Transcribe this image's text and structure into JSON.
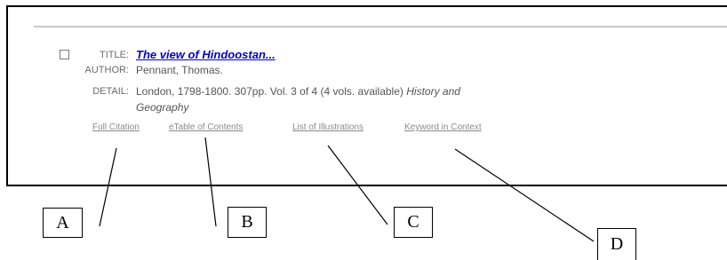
{
  "record": {
    "title_label": "TITLE:",
    "title_value": "The view of Hindoostan...",
    "author_label": "AUTHOR:",
    "author_value": "Pennant, Thomas.",
    "detail_label": "DETAIL:",
    "detail_value": "London, 1798-1800. 307pp. Vol. 3 of 4 (4 vols. available)",
    "detail_subject_1": "History and",
    "detail_subject_2": "Geography"
  },
  "links": {
    "full_citation": "Full Citation",
    "etable_of_contents": "eTable of Contents",
    "list_of_illustrations": "List of Illustrations",
    "keyword_in_context": "Keyword in Context"
  },
  "callouts": {
    "a": "A",
    "b": "B",
    "c": "C",
    "d": "D"
  }
}
